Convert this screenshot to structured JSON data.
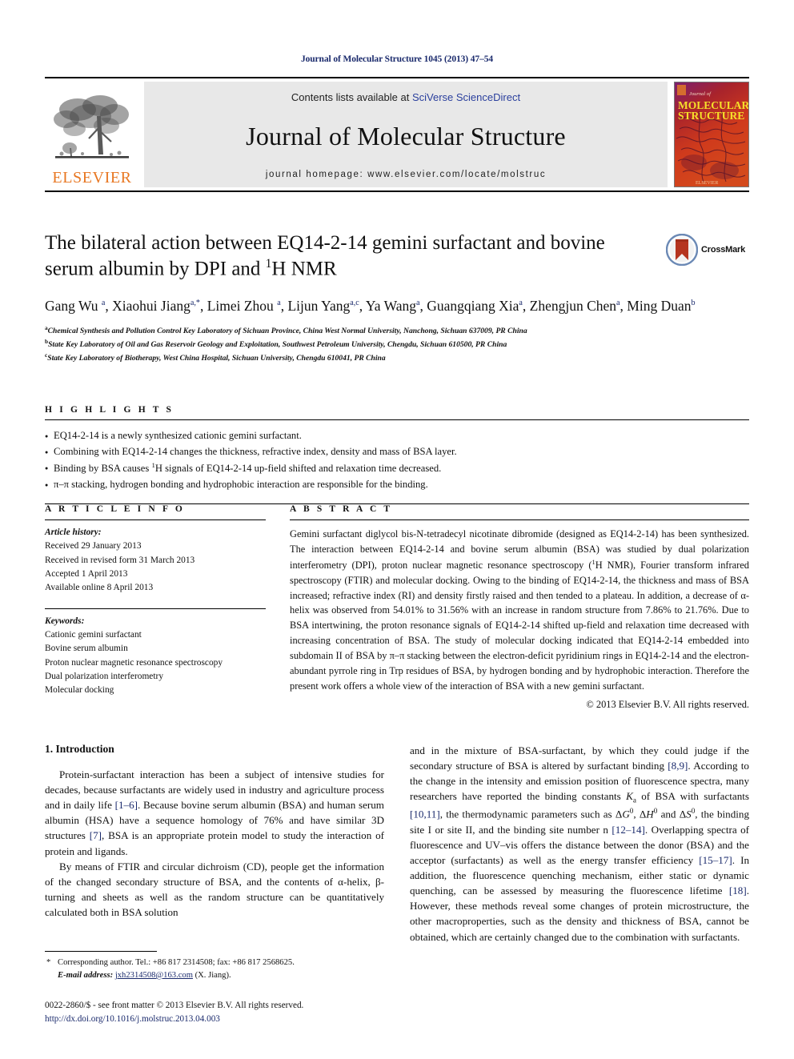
{
  "running_head": "Journal of Molecular Structure 1045 (2013) 47–54",
  "masthead": {
    "contents_prefix": "Contents lists available at ",
    "contents_link": "SciVerse ScienceDirect",
    "journal_title": "Journal of Molecular Structure",
    "homepage": "journal homepage: www.elsevier.com/locate/molstruc",
    "publisher": "ELSEVIER",
    "cover_line1": "Journal of",
    "cover_line2": "MOLECULAR",
    "cover_line3": "STRUCTURE"
  },
  "title": {
    "line1": "The bilateral action between EQ14-2-14 gemini surfactant and bovine",
    "line2_pre": "serum albumin by DPI and ",
    "line2_sup": "1",
    "line2_post": "H NMR",
    "crossmark_label": "CrossMark"
  },
  "authors_html": "Gang Wu <sup>a</sup>, Xiaohui Jiang<sup>a,*</sup>, Limei Zhou <sup>a</sup>, Lijun Yang<sup>a,c</sup>, Ya Wang<sup>a</sup>, Guangqiang Xia<sup>a</sup>, Zhengjun Chen<sup>a</sup>, Ming Duan<sup>b</sup>",
  "affiliations": [
    {
      "mark": "a",
      "text": "Chemical Synthesis and Pollution Control Key Laboratory of Sichuan Province, China West Normal University, Nanchong, Sichuan 637009, PR China"
    },
    {
      "mark": "b",
      "text": "State Key Laboratory of Oil and Gas Reservoir Geology and Exploitation, Southwest Petroleum University, Chengdu, Sichuan 610500, PR China"
    },
    {
      "mark": "c",
      "text": "State Key Laboratory of Biotherapy, West China Hospital, Sichuan University, Chengdu 610041, PR China"
    }
  ],
  "highlights": {
    "heading": "H I G H L I G H T S",
    "items_html": [
      "EQ14-2-14 is a newly synthesized cationic gemini surfactant.",
      "Combining with EQ14-2-14 changes the thickness, refractive index, density and mass of BSA layer.",
      "Binding by BSA causes <sup>1</sup>H signals of EQ14-2-14 up-field shifted and relaxation time decreased.",
      "&#960;&#8211;&#960; stacking, hydrogen bonding and hydrophobic interaction are responsible for the binding."
    ]
  },
  "article_info": {
    "heading": "A R T I C L E    I N F O",
    "history_label": "Article history:",
    "history": [
      "Received 29 January 2013",
      "Received in revised form 31 March 2013",
      "Accepted 1 April 2013",
      "Available online 8 April 2013"
    ],
    "keywords_label": "Keywords:",
    "keywords": [
      "Cationic gemini surfactant",
      "Bovine serum albumin",
      "Proton nuclear magnetic resonance spectroscopy",
      "Dual polarization interferometry",
      "Molecular docking"
    ]
  },
  "abstract": {
    "heading": "A B S T R A C T",
    "body_html": "Gemini surfactant diglycol bis-N-tetradecyl nicotinate dibromide (designed as EQ14-2-14) has been synthesized. The interaction between EQ14-2-14 and bovine serum albumin (BSA) was studied by dual polarization interferometry (DPI), proton nuclear magnetic resonance spectroscopy (<sup>1</sup>H NMR), Fourier transform infrared spectroscopy (FTIR) and molecular docking. Owing to the binding of EQ14-2-14, the thickness and mass of BSA increased; refractive index (RI) and density firstly raised and then tended to a plateau. In addition, a decrease of &#945;-helix was observed from 54.01% to 31.56% with an increase in random structure from 7.86% to 21.76%. Due to BSA intertwining, the proton resonance signals of EQ14-2-14 shifted up-field and relaxation time decreased with increasing concentration of BSA. The study of molecular docking indicated that EQ14-2-14 embedded into subdomain II of BSA by &#960;&#8211;&#960; stacking between the electron-deficit pyridinium rings in EQ14-2-14 and the electron-abundant pyrrole ring in Trp residues of BSA, by hydrogen bonding and by hydrophobic interaction. Therefore the present work offers a whole view of the interaction of BSA with a new gemini surfactant.",
    "copyright": "&#169; 2013 Elsevier B.V. All rights reserved."
  },
  "introduction": {
    "section_title": "1. Introduction",
    "left_paragraphs_html": [
      "Protein-surfactant interaction has been a subject of intensive studies for decades, because surfactants are widely used in industry and agriculture process and in daily life <span class=\"ref\">[1&#8211;6]</span>. Because bovine serum albumin (BSA) and human serum albumin (HSA) have a sequence homology of 76% and have similar 3D structures <span class=\"ref\">[7]</span>, BSA is an appropriate protein model to study the interaction of protein and ligands.",
      "By means of FTIR and circular dichroism (CD), people get the information of the changed secondary structure of BSA, and the contents of &#945;-helix, &#946;-turning and sheets as well as the random structure can be quantitatively calculated both in BSA solution"
    ],
    "right_paragraphs_html": [
      "and in the mixture of BSA-surfactant, by which they could judge if the secondary structure of BSA is altered by surfactant binding <span class=\"ref\">[8,9]</span>. According to the change in the intensity and emission position of fluorescence spectra, many researchers have reported the binding constants <i>K</i><sub>a</sub> of BSA with surfactants <span class=\"ref\">[10,11]</span>, the thermodynamic parameters such as &#916;<i>G</i><sup>0</sup>, &#916;<i>H</i><sup>0</sup> and &#916;<i>S</i><sup>0</sup>, the binding site I or site II, and the binding site number n <span class=\"ref\">[12&#8211;14]</span>. Overlapping spectra of fluorescence and UV&#8211;vis offers the distance between the donor (BSA) and the acceptor (surfactants) as well as the energy transfer efficiency <span class=\"ref\">[15&#8211;17]</span>. In addition, the fluorescence quenching mechanism, either static or dynamic quenching, can be assessed by measuring the fluorescence lifetime <span class=\"ref\">[18]</span>. However, these methods reveal some changes of protein microstructure, the other macroproperties, such as the density and thickness of BSA, cannot be obtained, which are certainly changed due to the combination with surfactants."
    ]
  },
  "footnote": {
    "star": "*",
    "corresponding_html": "Corresponding author. Tel.: +86 817 2314508; fax: +86 817 2568625.",
    "email_label": "E-mail address:",
    "email": "jxh2314508@163.com",
    "email_owner": "(X. Jiang)."
  },
  "imprint": {
    "issn_line": "0022-2860/$ - see front matter &#169; 2013 Elsevier B.V. All rights reserved.",
    "doi": "http://dx.doi.org/10.1016/j.molstruc.2013.04.003"
  },
  "colors": {
    "link_blue": "#2a3f9d",
    "ref_blue": "#1a2a6c",
    "elsevier_orange": "#E87722",
    "masthead_grey": "#e8e8e8",
    "crossmark_red": "#b5341f",
    "crossmark_blue": "#4a6fa5"
  }
}
